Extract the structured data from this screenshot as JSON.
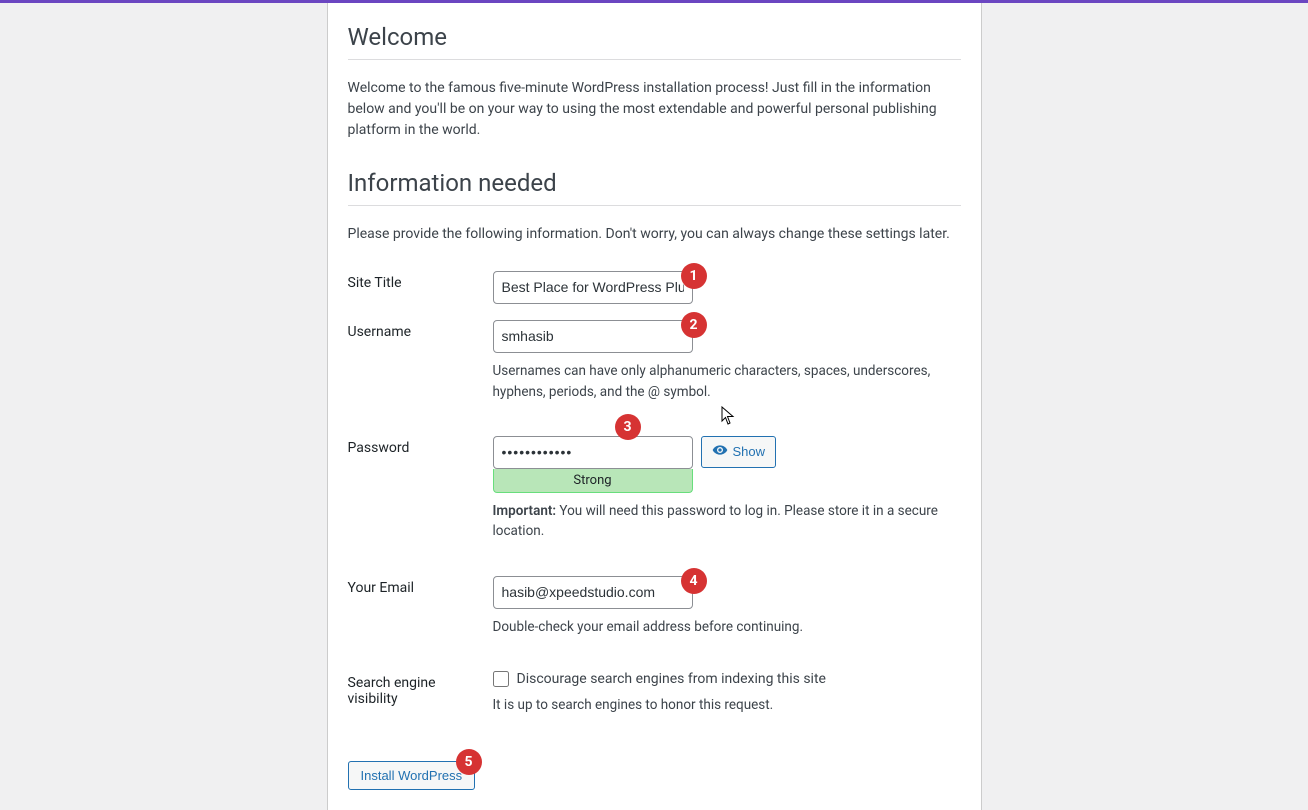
{
  "headings": {
    "welcome": "Welcome",
    "info_needed": "Information needed"
  },
  "intro": {
    "welcome_text": "Welcome to the famous five-minute WordPress installation process! Just fill in the information below and you'll be on your way to using the most extendable and powerful personal publishing platform in the world.",
    "info_text": "Please provide the following information. Don't worry, you can always change these settings later."
  },
  "fields": {
    "site_title": {
      "label": "Site Title",
      "value": "Best Place for WordPress Plugi"
    },
    "username": {
      "label": "Username",
      "value": "smhasib",
      "hint": "Usernames can have only alphanumeric characters, spaces, underscores, hyphens, periods, and the @ symbol."
    },
    "password": {
      "label": "Password",
      "value": "••••••••••••",
      "strength": "Strong",
      "show_label": "Show",
      "important_label": "Important:",
      "important_text": " You will need this password to log in. Please store it in a secure location."
    },
    "email": {
      "label": "Your Email",
      "value": "hasib@xpeedstudio.com",
      "hint": "Double-check your email address before continuing."
    },
    "visibility": {
      "label": "Search engine visibility",
      "checkbox_label": "Discourage search engines from indexing this site",
      "hint": "It is up to search engines to honor this request."
    }
  },
  "buttons": {
    "install": "Install WordPress"
  },
  "markers": {
    "m1": "1",
    "m2": "2",
    "m3": "3",
    "m4": "4",
    "m5": "5"
  }
}
